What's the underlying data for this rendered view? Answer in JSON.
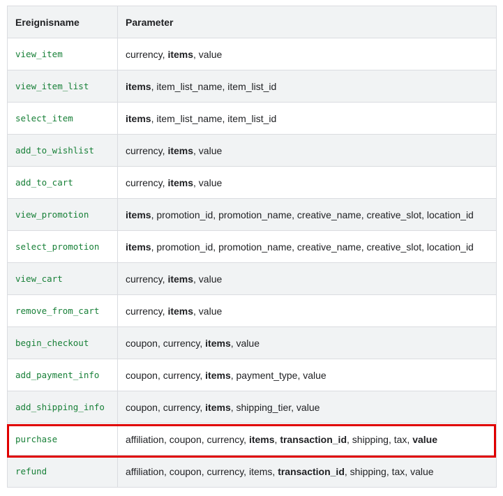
{
  "table": {
    "headers": [
      "Ereignisname",
      "Parameter"
    ],
    "rows": [
      {
        "event": "view_item",
        "params": [
          {
            "t": "currency",
            "b": false
          },
          {
            "t": "items",
            "b": true
          },
          {
            "t": "value",
            "b": false
          }
        ]
      },
      {
        "event": "view_item_list",
        "params": [
          {
            "t": "items",
            "b": true
          },
          {
            "t": "item_list_name",
            "b": false
          },
          {
            "t": "item_list_id",
            "b": false
          }
        ]
      },
      {
        "event": "select_item",
        "params": [
          {
            "t": "items",
            "b": true
          },
          {
            "t": "item_list_name",
            "b": false
          },
          {
            "t": "item_list_id",
            "b": false
          }
        ]
      },
      {
        "event": "add_to_wishlist",
        "params": [
          {
            "t": "currency",
            "b": false
          },
          {
            "t": "items",
            "b": true
          },
          {
            "t": "value",
            "b": false
          }
        ]
      },
      {
        "event": "add_to_cart",
        "params": [
          {
            "t": "currency",
            "b": false
          },
          {
            "t": "items",
            "b": true
          },
          {
            "t": "value",
            "b": false
          }
        ]
      },
      {
        "event": "view_promotion",
        "params": [
          {
            "t": "items",
            "b": true
          },
          {
            "t": "promotion_id",
            "b": false
          },
          {
            "t": "promotion_name",
            "b": false
          },
          {
            "t": "creative_name",
            "b": false
          },
          {
            "t": "creative_slot",
            "b": false
          },
          {
            "t": "location_id",
            "b": false
          }
        ]
      },
      {
        "event": "select_promotion",
        "params": [
          {
            "t": "items",
            "b": true
          },
          {
            "t": "promotion_id",
            "b": false
          },
          {
            "t": "promotion_name",
            "b": false
          },
          {
            "t": "creative_name",
            "b": false
          },
          {
            "t": "creative_slot",
            "b": false
          },
          {
            "t": "location_id",
            "b": false
          }
        ]
      },
      {
        "event": "view_cart",
        "params": [
          {
            "t": "currency",
            "b": false
          },
          {
            "t": "items",
            "b": true
          },
          {
            "t": "value",
            "b": false
          }
        ]
      },
      {
        "event": "remove_from_cart",
        "params": [
          {
            "t": "currency",
            "b": false
          },
          {
            "t": "items",
            "b": true
          },
          {
            "t": "value",
            "b": false
          }
        ]
      },
      {
        "event": "begin_checkout",
        "params": [
          {
            "t": "coupon",
            "b": false
          },
          {
            "t": "currency",
            "b": false
          },
          {
            "t": "items",
            "b": true
          },
          {
            "t": "value",
            "b": false
          }
        ]
      },
      {
        "event": "add_payment_info",
        "params": [
          {
            "t": "coupon",
            "b": false
          },
          {
            "t": "currency",
            "b": false
          },
          {
            "t": "items",
            "b": true
          },
          {
            "t": "payment_type",
            "b": false
          },
          {
            "t": "value",
            "b": false
          }
        ]
      },
      {
        "event": "add_shipping_info",
        "params": [
          {
            "t": "coupon",
            "b": false
          },
          {
            "t": "currency",
            "b": false
          },
          {
            "t": "items",
            "b": true
          },
          {
            "t": "shipping_tier",
            "b": false
          },
          {
            "t": "value",
            "b": false
          }
        ]
      },
      {
        "event": "purchase",
        "highlighted": true,
        "params": [
          {
            "t": "affiliation",
            "b": false
          },
          {
            "t": "coupon",
            "b": false
          },
          {
            "t": "currency",
            "b": false
          },
          {
            "t": "items",
            "b": true
          },
          {
            "t": "transaction_id",
            "b": true
          },
          {
            "t": "shipping",
            "b": false
          },
          {
            "t": "tax",
            "b": false
          },
          {
            "t": "value",
            "b": true
          }
        ]
      },
      {
        "event": "refund",
        "params": [
          {
            "t": "affiliation",
            "b": false
          },
          {
            "t": "coupon",
            "b": false
          },
          {
            "t": "currency",
            "b": false
          },
          {
            "t": "items",
            "b": false
          },
          {
            "t": "transaction_id",
            "b": true
          },
          {
            "t": "shipping",
            "b": false
          },
          {
            "t": "tax",
            "b": false
          },
          {
            "t": "value",
            "b": false
          }
        ]
      }
    ]
  },
  "colors": {
    "event_name": "#188038",
    "highlight_border": "#e00000",
    "header_bg": "#f1f3f4",
    "border": "#dadce0"
  }
}
